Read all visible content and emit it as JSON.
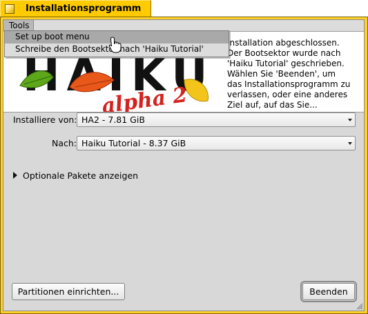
{
  "window": {
    "title": "Installationsprogramm"
  },
  "menubar": {
    "tools_label": "Tools"
  },
  "tools_menu": {
    "items": [
      {
        "label": "Set up boot menu"
      },
      {
        "label": "Schreibe den Bootsektor nach 'Haiku Tutorial'"
      }
    ]
  },
  "header": {
    "logo_text": "HAIKU",
    "logo_subtext": "alpha 2",
    "status": "Installation abgeschlossen.\nDer Bootsektor wurde nach\n'Haiku Tutorial' geschrieben.\nWählen Sie 'Beenden', um\ndas Installationsprogramm zu\nverlassen, oder eine anderes\nZiel auf, auf das Sie..."
  },
  "form": {
    "source_label": "Installiere von:",
    "source_value": "HA2 - 7.81 GiB",
    "target_label": "Nach:",
    "target_value": "Haiku Tutorial - 8.37 GiB",
    "optional_packages_label": "Optionale Pakete anzeigen"
  },
  "buttons": {
    "partition_label": "Partitionen einrichten...",
    "quit_label": "Beenden"
  },
  "colors": {
    "title_tab": "#ffcb00",
    "window_frame": "#ffd02a",
    "panel": "#d8d8d8"
  }
}
